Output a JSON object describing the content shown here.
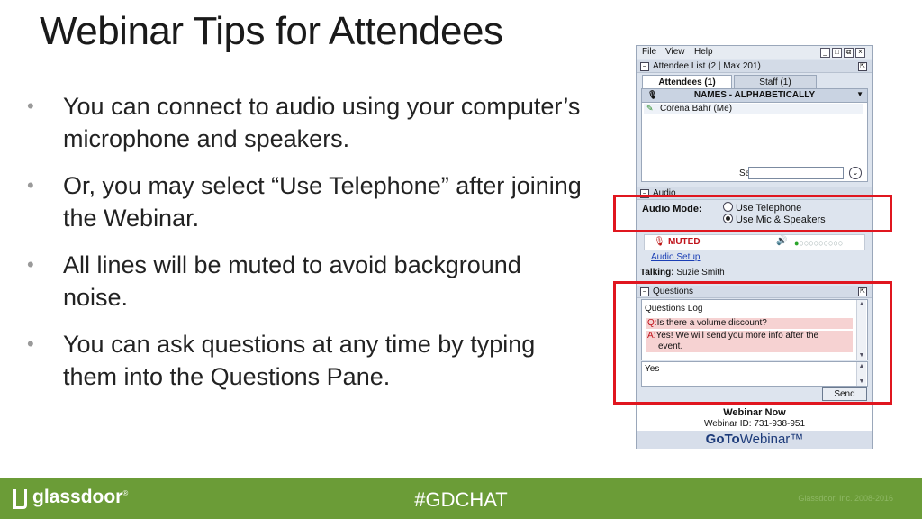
{
  "slide": {
    "title": "Webinar Tips for Attendees",
    "bullets": [
      "You can connect to audio using your computer’s microphone and speakers.",
      "Or, you may select “Use Telephone” after joining the Webinar.",
      "All lines will be muted to avoid background noise.",
      "You can ask questions at any time by typing them into the Questions Pane."
    ]
  },
  "panel": {
    "menu": [
      "File",
      "View",
      "Help"
    ],
    "window_buttons": [
      "_",
      "□",
      "⧉",
      "×"
    ],
    "attendee_section": {
      "label": "Attendee List",
      "count": "(2 | Max 201)",
      "tabs": [
        {
          "label": "Attendees (1)",
          "active": true
        },
        {
          "label": "Staff (1)",
          "active": false
        }
      ],
      "list_header": "NAMES - ALPHABETICALLY",
      "attendees": [
        "Corena Bahr (Me)"
      ],
      "search_label": "Search",
      "search_value": ""
    },
    "audio_section": {
      "label": "Audio",
      "mode_label": "Audio Mode:",
      "options": [
        {
          "label": "Use Telephone",
          "selected": false
        },
        {
          "label": "Use Mic & Speakers",
          "selected": true
        }
      ],
      "mic_status": "MUTED",
      "meter_level_filled": 1,
      "meter_level_total": 10,
      "setup_link": "Audio Setup",
      "talking_label": "Talking:",
      "talking_name": "Suzie Smith"
    },
    "questions_section": {
      "label": "Questions",
      "log_title": "Questions Log",
      "q_prefix": "Q:",
      "question": "Is there a volume discount?",
      "a_prefix": "A:",
      "answer_line1": "Yes! We will send you more info after the",
      "answer_line2": "event.",
      "input_value": "Yes",
      "send_label": "Send"
    },
    "webinar": {
      "title": "Webinar Now",
      "id_text": "Webinar ID: 731-938-951",
      "brand_bold": "GoTo",
      "brand_light": "Webinar™"
    }
  },
  "footer": {
    "logo": "glassdoor",
    "logo_mark": "®",
    "hashtag": "#GDCHAT",
    "copyright": "Glassdoor, Inc. 2008-2016"
  },
  "colors": {
    "highlight": "#e0161f",
    "footer_bg": "#6b9c37",
    "muted": "#c0121a",
    "link": "#1b3fb5"
  }
}
